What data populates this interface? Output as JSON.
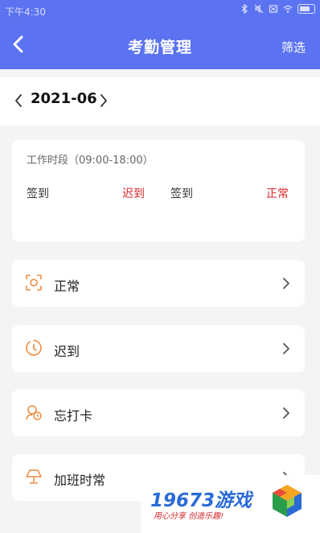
{
  "status_bar": {
    "time": "下午4:30"
  },
  "nav": {
    "title": "考勤管理",
    "filter_label": "筛选"
  },
  "month": {
    "label": "2021-06"
  },
  "work_card": {
    "title": "工作时段（09:00-18:00）",
    "entries": [
      {
        "label": "签到",
        "status": "迟到"
      },
      {
        "label": "签到",
        "status": "正常"
      }
    ]
  },
  "items": [
    {
      "label": "正常",
      "icon": "scan-icon"
    },
    {
      "label": "迟到",
      "icon": "timer-icon"
    },
    {
      "label": "忘打卡",
      "icon": "user-clock-icon"
    },
    {
      "label": "加班时常",
      "icon": "lamp-icon"
    }
  ],
  "watermark": {
    "brand": "19673游戏",
    "tagline": "用心分享 创造乐趣!"
  },
  "colors": {
    "accent": "#5b73f0",
    "alert": "#d9262b",
    "icon": "#f08a3c"
  }
}
